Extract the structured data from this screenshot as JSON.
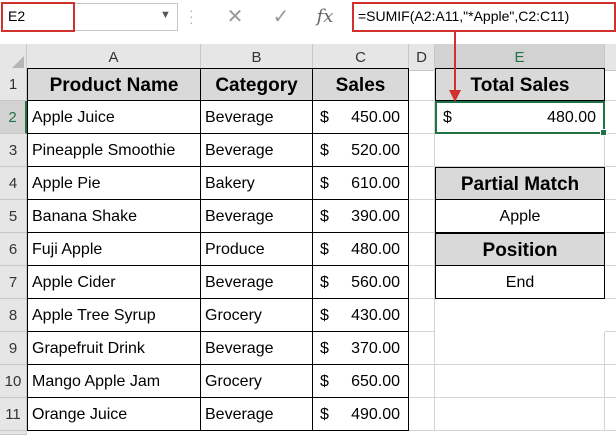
{
  "formula_bar": {
    "name_box": "E2",
    "cancel_icon": "✕",
    "enter_icon": "✓",
    "fx_label": "fx",
    "formula": "=SUMIF(A2:A11,\"*Apple\",C2:C11)"
  },
  "columns": [
    "A",
    "B",
    "C",
    "D",
    "E"
  ],
  "rows": [
    "1",
    "2",
    "3",
    "4",
    "5",
    "6",
    "7",
    "8",
    "9",
    "10",
    "11"
  ],
  "table": {
    "headers": [
      "Product Name",
      "Category",
      "Sales"
    ],
    "rows": [
      {
        "product": "Apple Juice",
        "category": "Beverage",
        "currency": "$",
        "sales": "450.00"
      },
      {
        "product": "Pineapple Smoothie",
        "category": "Beverage",
        "currency": "$",
        "sales": "520.00"
      },
      {
        "product": "Apple Pie",
        "category": "Bakery",
        "currency": "$",
        "sales": "610.00"
      },
      {
        "product": "Banana Shake",
        "category": "Beverage",
        "currency": "$",
        "sales": "390.00"
      },
      {
        "product": "Fuji Apple",
        "category": "Produce",
        "currency": "$",
        "sales": "480.00"
      },
      {
        "product": "Apple Cider",
        "category": "Beverage",
        "currency": "$",
        "sales": "560.00"
      },
      {
        "product": "Apple Tree Syrup",
        "category": "Grocery",
        "currency": "$",
        "sales": "430.00"
      },
      {
        "product": "Grapefruit Drink",
        "category": "Beverage",
        "currency": "$",
        "sales": "370.00"
      },
      {
        "product": "Mango Apple Jam",
        "category": "Grocery",
        "currency": "$",
        "sales": "650.00"
      },
      {
        "product": "Orange Juice",
        "category": "Beverage",
        "currency": "$",
        "sales": "490.00"
      }
    ]
  },
  "summary": {
    "total_label": "Total Sales",
    "total_currency": "$",
    "total_value": "480.00",
    "partial_label": "Partial Match",
    "partial_value": "Apple",
    "position_label": "Position",
    "position_value": "End"
  },
  "colors": {
    "accent": "#217346",
    "highlight": "#d0312d",
    "header_fill": "#d9d9d9"
  }
}
